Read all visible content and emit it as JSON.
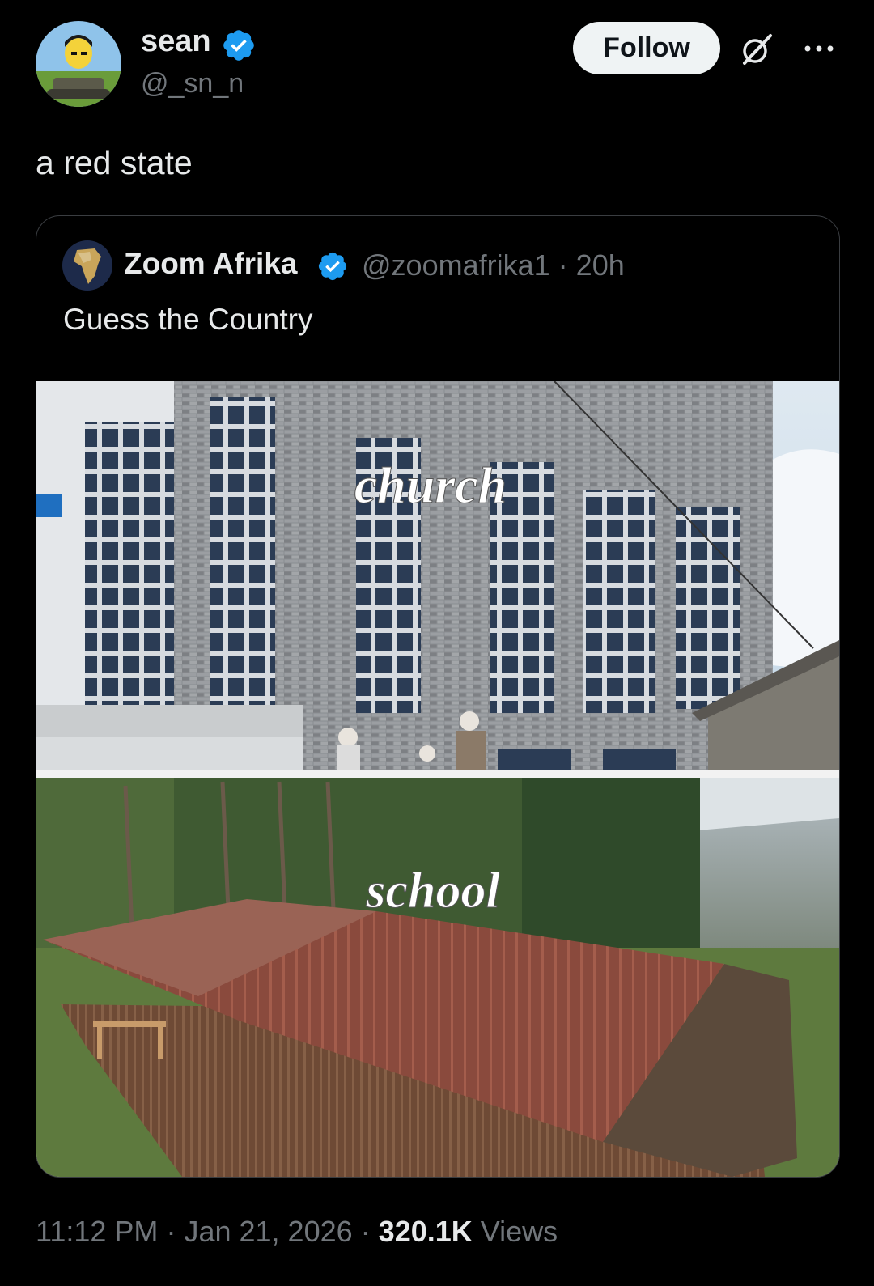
{
  "author": {
    "display_name": "sean",
    "handle": "@_sn_n",
    "verified_icon": "verified-badge-icon",
    "avatar_icon": "cartoon-avatar"
  },
  "actions": {
    "follow_label": "Follow",
    "grok_icon": "grok-icon",
    "more_icon": "more-icon"
  },
  "tweet": {
    "text": "a red state"
  },
  "quote": {
    "display_name": "Zoom Afrika",
    "handle": "@zoomafrika1",
    "separator": "·",
    "time": "20h",
    "text": "Guess the Country",
    "image_top_label": "church",
    "image_bottom_label": "school"
  },
  "meta": {
    "time": "11:12 PM",
    "sep1": "·",
    "date": "Jan 21, 2026",
    "sep2": "·",
    "views_count": "320.1K",
    "views_label": "Views"
  },
  "colors": {
    "background": "#000000",
    "text": "#e7e9ea",
    "muted": "#71767b",
    "verified": "#1d9bf0",
    "follow_bg": "#eff3f4"
  }
}
